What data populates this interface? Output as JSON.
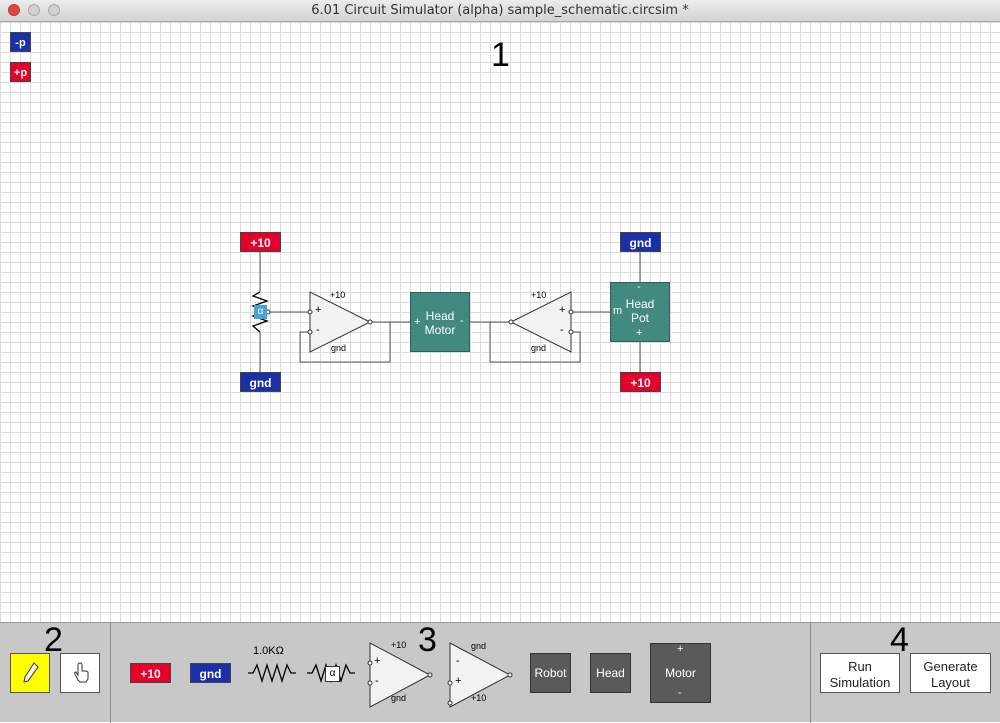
{
  "window": {
    "title": "6.01 Circuit Simulator (alpha) sample_schematic.circsim *"
  },
  "labels": {
    "region1": "1",
    "region2": "2",
    "region3": "3",
    "region4": "4"
  },
  "probes": {
    "minus": "-p",
    "plus": "+p"
  },
  "schematic": {
    "supply_top_left": "+10",
    "gnd_bottom_left": "gnd",
    "pot_label": "α",
    "opamp1": {
      "top": "+10",
      "bottom": "gnd",
      "plus": "+",
      "minus": "-"
    },
    "motor": {
      "line1": "Head",
      "line2": "Motor",
      "plus": "+",
      "minus": "-"
    },
    "opamp2": {
      "top": "+10",
      "bottom": "gnd",
      "plus": "+",
      "minus": "-"
    },
    "headpot": {
      "line1": "Head",
      "line2": "Pot",
      "minus": "-",
      "plus": "+",
      "m": "m"
    },
    "gnd_top_right": "gnd",
    "supply_bottom_right": "+10"
  },
  "toolbar": {
    "palette": {
      "supply": "+10",
      "gnd": "gnd",
      "resistor": "1.0KΩ",
      "pot": "α",
      "opamp_a": {
        "top": "+10",
        "bottom": "gnd",
        "plus": "+",
        "minus": "-"
      },
      "opamp_b": {
        "top": "gnd",
        "bottom": "+10",
        "plus": "+",
        "minus": "-"
      },
      "robot": "Robot",
      "head": "Head",
      "motor": {
        "label": "Motor",
        "plus": "+",
        "minus": "-"
      }
    },
    "run_simulation": "Run\nSimulation",
    "generate_layout": "Generate\nLayout"
  },
  "colors": {
    "supply": "#e4002b",
    "ground": "#1a2fa8",
    "block": "#428a7f",
    "pencil_tool": "#ffff00"
  }
}
